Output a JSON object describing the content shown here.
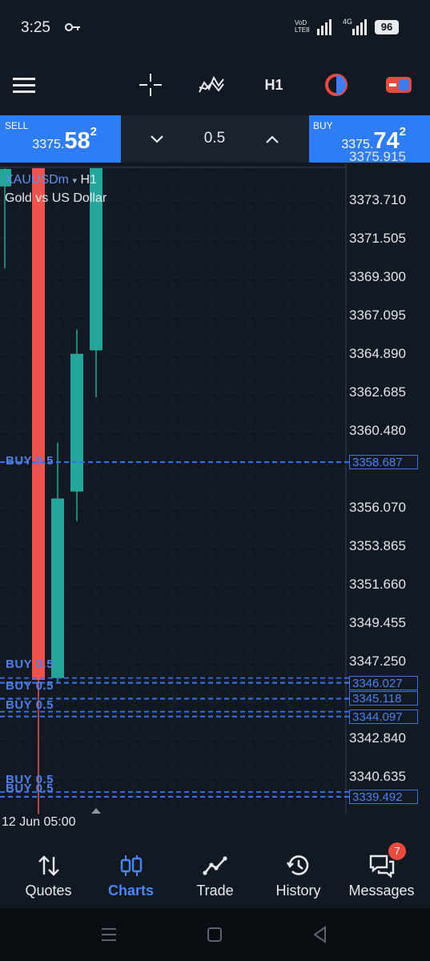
{
  "status": {
    "time": "3:25",
    "net_left": "VoD LTE8",
    "net_right": "4G",
    "battery": "96"
  },
  "toolbar": {
    "timeframe": "H1"
  },
  "trade": {
    "sell": {
      "label": "SELL",
      "prefix": "3375.",
      "big": "58",
      "sup": "2"
    },
    "buy": {
      "label": "BUY",
      "prefix": "3375.",
      "big": "74",
      "sup": "2"
    },
    "volume": "0.5"
  },
  "chart": {
    "symbol": "XAUUSDm",
    "timeframe": "H1",
    "description": "Gold vs US Dollar",
    "time_label": "12 Jun 05:00",
    "axis_top_partial": "3375.915",
    "axis_ticks": [
      "3373.710",
      "3371.505",
      "3369.300",
      "3367.095",
      "3364.890",
      "3362.685",
      "3360.480",
      "3356.070",
      "3353.865",
      "3351.660",
      "3349.455",
      "3347.250",
      "3342.840",
      "3340.635"
    ],
    "price_tags": [
      "3358.687",
      "3346.027",
      "3345.118",
      "3344.097",
      "3339.492"
    ],
    "order_labels": [
      "BUY 0.5",
      "BUY 0.5",
      "BUY 0.5",
      "BUY 0.5",
      "BUY 0.5",
      "BUY 0.5"
    ],
    "colors": {
      "bull": "#26a69a",
      "bear": "#ef5350",
      "order_line": "#3a6fe0",
      "grid": "#232c3a"
    }
  },
  "chart_data": {
    "type": "candlestick",
    "symbol": "XAUUSDm",
    "timeframe": "H1",
    "ylim": [
      3338.5,
      3376.5
    ],
    "candles": [
      {
        "open": 3374.5,
        "high": 3376.0,
        "low": 3369.8,
        "close": 3375.5
      },
      {
        "open": 3375.6,
        "high": 3376.0,
        "low": 3338.5,
        "close": 3346.2
      },
      {
        "open": 3346.3,
        "high": 3359.8,
        "low": 3346.0,
        "close": 3356.6
      },
      {
        "open": 3357.0,
        "high": 3366.3,
        "low": 3355.3,
        "close": 3364.9
      },
      {
        "open": 3365.1,
        "high": 3376.0,
        "low": 3362.4,
        "close": 3376.0
      }
    ],
    "order_levels": [
      3358.687,
      3346.027,
      3345.118,
      3344.097,
      3339.492
    ]
  },
  "nav": {
    "items": [
      {
        "label": "Quotes"
      },
      {
        "label": "Charts"
      },
      {
        "label": "Trade"
      },
      {
        "label": "History"
      },
      {
        "label": "Messages"
      }
    ],
    "messages_badge": "7"
  }
}
